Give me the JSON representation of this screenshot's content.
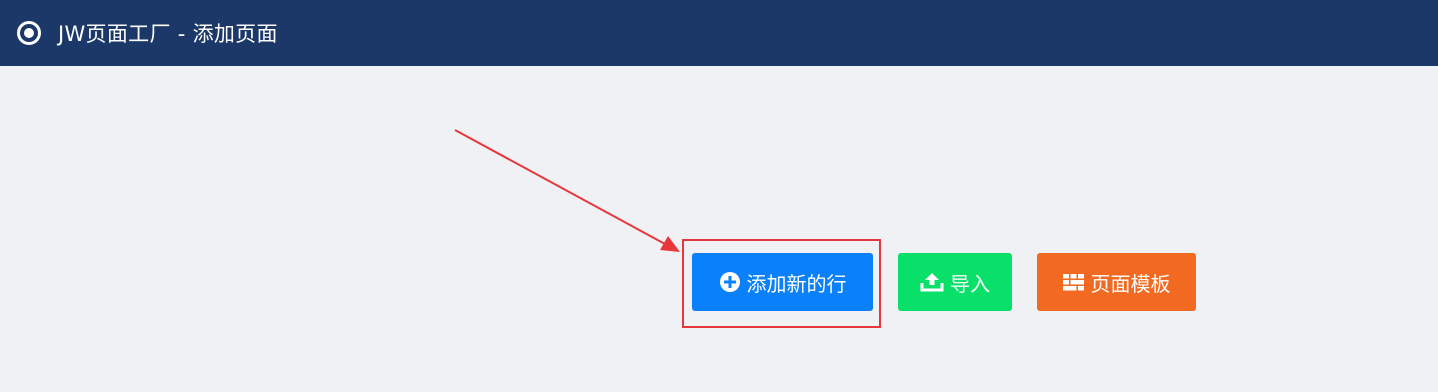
{
  "header": {
    "title": "JW页面工厂 - 添加页面",
    "icon": "radio-target-icon",
    "background": "#1b3869"
  },
  "actions": {
    "add_row": {
      "label": "添加新的行",
      "icon": "plus-circle-icon",
      "color": "#0b80fb"
    },
    "import": {
      "label": "导入",
      "icon": "upload-icon",
      "color": "#08e06a"
    },
    "template": {
      "label": "页面模板",
      "icon": "grid-icon",
      "color": "#f26a21"
    }
  },
  "annotation": {
    "color": "#e8373a",
    "target": "add_row"
  }
}
